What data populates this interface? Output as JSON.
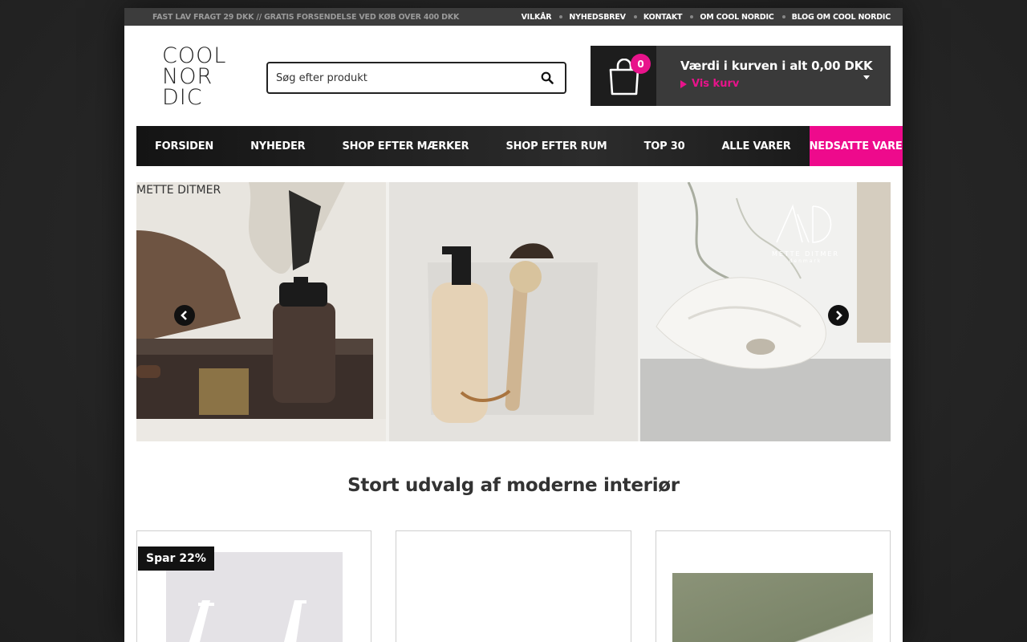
{
  "topbar": {
    "promo": "FAST LAV FRAGT 29 DKK // GRATIS FORSENDELSE VED KØB OVER 400 DKK",
    "links": [
      "VILKÅR",
      "NYHEDSBREV",
      "KONTAKT",
      "OM COOL NORDIC",
      "BLOG OM COOL NORDIC"
    ]
  },
  "logo": {
    "lines": [
      "COOL",
      "NOR",
      "DIC"
    ]
  },
  "search": {
    "placeholder": "Søg efter produkt",
    "icon": "search-icon"
  },
  "cart": {
    "count": "0",
    "value_label": "Værdi i kurven i alt 0,00 DKK",
    "show_label": "Vis kurv"
  },
  "nav": {
    "items": [
      "FORSIDEN",
      "NYHEDER",
      "SHOP EFTER MÆRKER",
      "SHOP EFTER RUM",
      "TOP 30",
      "ALLE VARER"
    ],
    "sale": "NEDSATTE VARER"
  },
  "slider": {
    "brand": "METTE DITMER",
    "logo_line1": "METTE DITMER",
    "logo_line2": "denmark"
  },
  "section": {
    "title": "Stort udvalg af moderne interiør"
  },
  "products": [
    {
      "tag": "Spar 22%"
    }
  ],
  "colors": {
    "accent": "#e8138b",
    "dark": "#1d1d1d",
    "topbar": "#3c3c3c"
  }
}
